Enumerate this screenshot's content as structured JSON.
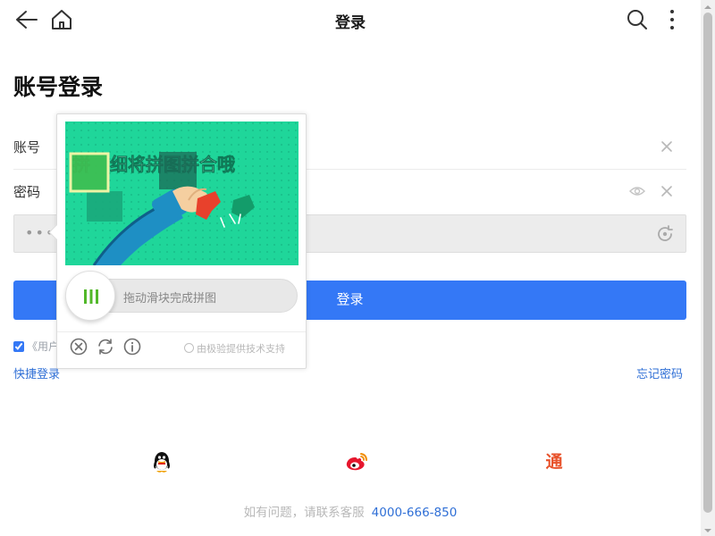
{
  "topbar": {
    "title": "登录"
  },
  "heading": "账号登录",
  "form": {
    "account_label": "账号",
    "password_label": "密码",
    "captcha_dots": "•••",
    "login_button": "登录",
    "agree_text": "《用户",
    "quick_login": "快捷登录",
    "forgot_password": "忘记密码"
  },
  "captcha": {
    "banner_text": "细将拼图拼合哦",
    "slider_hint": "拖动滑块完成拼图",
    "brand_text": "由极验提供技术支持",
    "bg_color": "#1fd69a",
    "handle_color": "#52b82a"
  },
  "social": {
    "tong_label": "通"
  },
  "footer": {
    "help_text": "如有问题，请联系客服",
    "phone": "4000-666-850"
  },
  "colors": {
    "primary": "#3478f6",
    "link": "#2f6fd6"
  }
}
